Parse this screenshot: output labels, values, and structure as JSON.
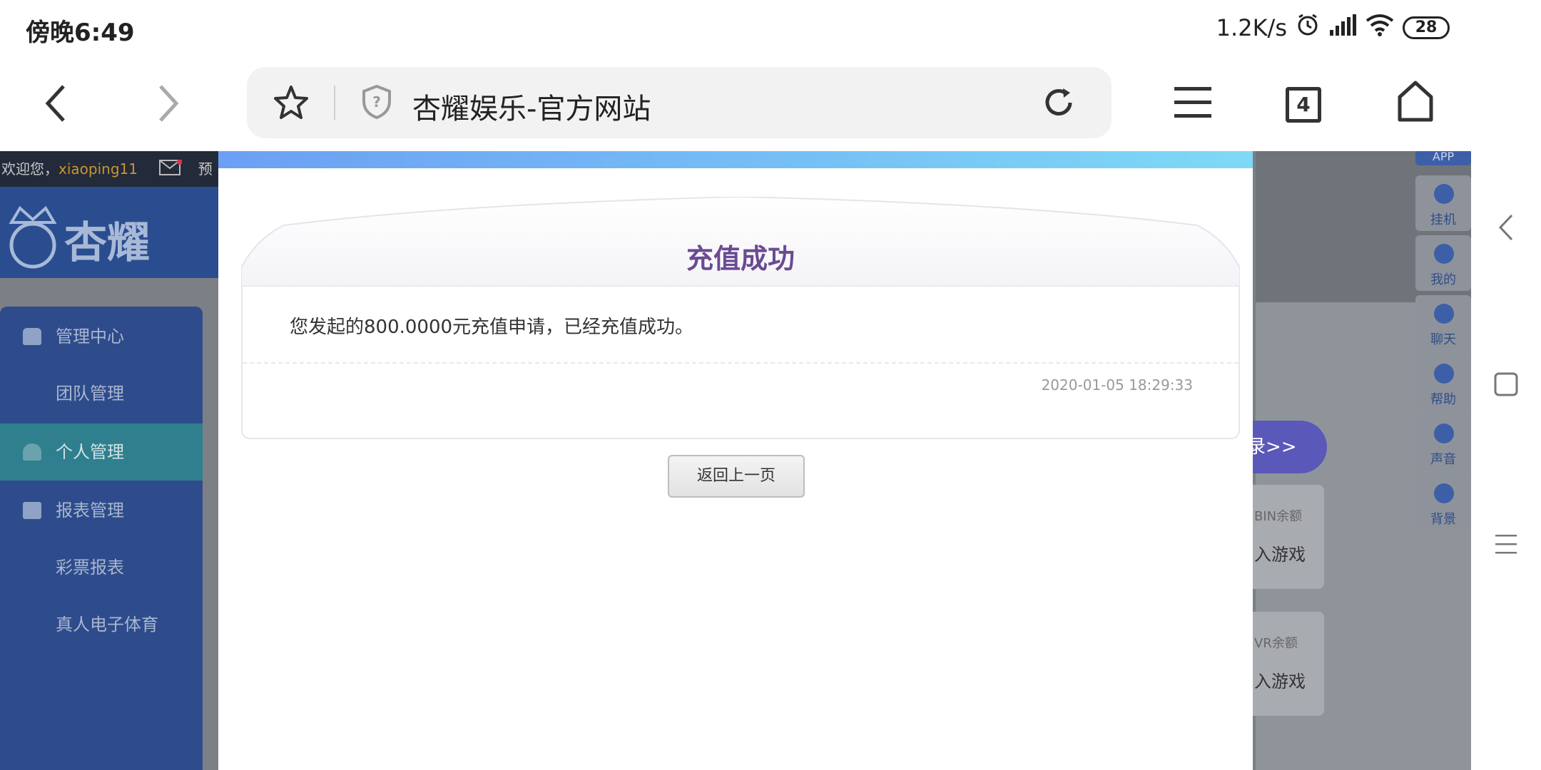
{
  "status_bar": {
    "time": "傍晚6:49",
    "network_speed": "1.2K/s",
    "battery": "28"
  },
  "browser": {
    "url_title": "杏耀娱乐-官方网站",
    "tab_count": "4"
  },
  "background_page": {
    "welcome": "欢迎您，",
    "username": "xiaoping11",
    "notice_prefix": "预留",
    "logo_text": "杏耀",
    "sidebar": [
      {
        "label": "管理中心",
        "has_icon": true,
        "active": false
      },
      {
        "label": "团队管理",
        "has_icon": false,
        "active": false
      },
      {
        "label": "个人管理",
        "has_icon": true,
        "active": true
      },
      {
        "label": "报表管理",
        "has_icon": true,
        "active": false
      },
      {
        "label": "彩票报表",
        "has_icon": false,
        "active": false
      },
      {
        "label": "真人电子体育",
        "has_icon": false,
        "active": false
      }
    ],
    "right_pill": "录>>",
    "right_cards": [
      {
        "label": "BIN余额",
        "action": "入游戏"
      },
      {
        "label": "VR余额",
        "action": "入游戏"
      }
    ],
    "tools": {
      "app": "APP",
      "items": [
        "挂机",
        "我的",
        "聊天",
        "帮助",
        "声音",
        "背景"
      ]
    }
  },
  "modal": {
    "title": "充值成功",
    "message": "您发起的800.0000元充值申请，已经充值成功。",
    "datetime": "2020-01-05 18:29:33",
    "back_button": "返回上一页"
  },
  "colors": {
    "modal_title": "#6b4a92",
    "topbar_gradient_start": "#6c9ff4",
    "topbar_gradient_end": "#7ed9f6",
    "sidebar": "#2e4c8c",
    "sidebar_active": "#2f7f8f"
  }
}
